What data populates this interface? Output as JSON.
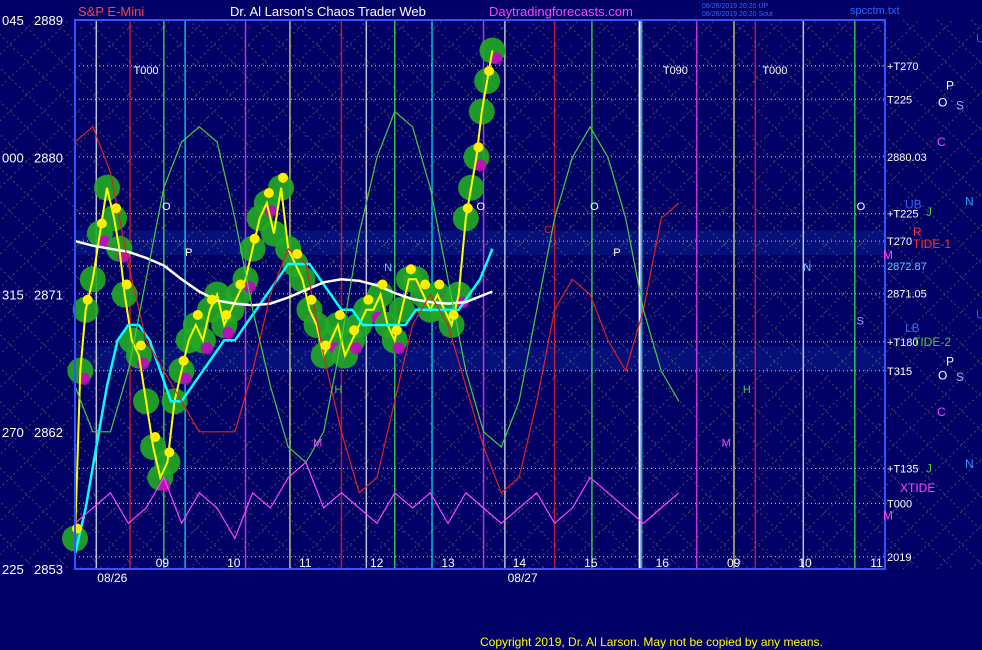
{
  "header": {
    "symbol": "S&P E-Mini",
    "title": "Dr. Al Larson's Chaos Trader Web",
    "site": "Daytradingforecasts.com",
    "stamp_line1": "08/26/2019 20:20 UP",
    "stamp_line2": "08/26/2019 20:20 Sout",
    "filename": "spcctm.txt"
  },
  "footer": {
    "copyright": "Copyright 2019, Dr. Al Larson. May not be copied by any means."
  },
  "colors": {
    "background": "#000066",
    "plot_bg": "#000066",
    "price_line": "#ffff00",
    "avg_fast": "#00ffff",
    "avg_slow": "#ffffff",
    "green_blob": "#22aa22",
    "magenta_blob": "#cc00cc",
    "grid_yellow": "#ffff66",
    "red": "#dd2222",
    "green_line": "#44cc44",
    "magenta_line": "#ff44ff",
    "frame": "#3355ff"
  },
  "chart_data": {
    "type": "line",
    "y_range": [
      2853,
      2889
    ],
    "left_axis": [
      {
        "left": "045",
        "right": "2889",
        "v": 2889
      },
      {
        "left": "000",
        "right": "2880",
        "v": 2880
      },
      {
        "left": "315",
        "right": "2871",
        "v": 2871
      },
      {
        "left": "270",
        "right": "2862",
        "v": 2862
      },
      {
        "left": "225",
        "right": "2853",
        "v": 2853
      }
    ],
    "right_labels": [
      {
        "text": "+T270",
        "v": 2886.0,
        "color": "#ffffff"
      },
      {
        "text": "T225",
        "v": 2883.8,
        "color": "#ffffff"
      },
      {
        "text": "2880.03",
        "v": 2880.03,
        "color": "#ffffff"
      },
      {
        "text": "+T225",
        "v": 2876.3,
        "color": "#ffffff"
      },
      {
        "text": "T270",
        "v": 2874.5,
        "color": "#ffffff"
      },
      {
        "text": "2872.87",
        "v": 2872.87,
        "color": "#66ccff"
      },
      {
        "text": "2871.05",
        "v": 2871.05,
        "color": "#ffffff"
      },
      {
        "text": "+T180",
        "v": 2867.9,
        "color": "#ffffff"
      },
      {
        "text": "T315",
        "v": 2866.0,
        "color": "#ffffff"
      },
      {
        "text": "+T135",
        "v": 2859.6,
        "color": "#ffffff"
      },
      {
        "text": "T000",
        "v": 2857.3,
        "color": "#ffffff"
      },
      {
        "text": "2019",
        "v": 2853.8,
        "color": "#ffffff"
      }
    ],
    "side_markers": [
      {
        "text": "U",
        "v": 2887.8,
        "x": 976,
        "color": "#3355ff"
      },
      {
        "text": "P",
        "v": 2884.7,
        "x": 946,
        "color": "#ffffff"
      },
      {
        "text": "O",
        "v": 2883.6,
        "x": 938,
        "color": "#ffffff"
      },
      {
        "text": "S",
        "v": 2883.4,
        "x": 956,
        "color": "#aaaaff"
      },
      {
        "text": "C",
        "v": 2881.0,
        "x": 937,
        "color": "#ff44ff"
      },
      {
        "text": "N",
        "v": 2877.1,
        "x": 965,
        "color": "#3399ff"
      },
      {
        "text": "UB",
        "v": 2876.9,
        "x": 905,
        "color": "#3366ff"
      },
      {
        "text": "J",
        "v": 2876.4,
        "x": 926,
        "color": "#44cc44"
      },
      {
        "text": "R",
        "v": 2875.1,
        "x": 913,
        "color": "#ff3333"
      },
      {
        "text": "TIDE-1",
        "v": 2874.3,
        "x": 913,
        "color": "#ff3333"
      },
      {
        "text": "M",
        "v": 2873.6,
        "x": 883,
        "color": "#ff44ff"
      },
      {
        "text": "U",
        "v": 2869.7,
        "x": 976,
        "color": "#3355ff"
      },
      {
        "text": "LB",
        "v": 2868.8,
        "x": 905,
        "color": "#3366ff"
      },
      {
        "text": "TIDE-2",
        "v": 2867.9,
        "x": 913,
        "color": "#44cc44"
      },
      {
        "text": "P",
        "v": 2866.6,
        "x": 946,
        "color": "#ffffff"
      },
      {
        "text": "O",
        "v": 2865.7,
        "x": 938,
        "color": "#ffffff"
      },
      {
        "text": "S",
        "v": 2865.6,
        "x": 956,
        "color": "#aaaaff"
      },
      {
        "text": "C",
        "v": 2863.3,
        "x": 937,
        "color": "#ff44ff"
      },
      {
        "text": "N",
        "v": 2859.9,
        "x": 965,
        "color": "#3399ff"
      },
      {
        "text": "J",
        "v": 2859.6,
        "x": 926,
        "color": "#44cc44"
      },
      {
        "text": "XTIDE",
        "v": 2858.3,
        "x": 900,
        "color": "#ff44ff"
      },
      {
        "text": "M",
        "v": 2856.5,
        "x": 883,
        "color": "#ff44ff"
      }
    ],
    "x_range": [
      0,
      34
    ],
    "hour_ticks": [
      {
        "text": "09",
        "x": 3
      },
      {
        "text": "10",
        "x": 6
      },
      {
        "text": "11",
        "x": 9
      },
      {
        "text": "12",
        "x": 12
      },
      {
        "text": "13",
        "x": 15
      },
      {
        "text": "14",
        "x": 18
      },
      {
        "text": "15",
        "x": 21
      },
      {
        "text": "16",
        "x": 24
      },
      {
        "text": "09",
        "x": 27
      },
      {
        "text": "10",
        "x": 30
      },
      {
        "text": "11",
        "x": 33
      }
    ],
    "date_labels": [
      {
        "text": "08/26",
        "x": 2.1
      },
      {
        "text": "08/27",
        "x": 25.2
      }
    ],
    "top_markers": [
      {
        "text": "T000",
        "x": 4.0
      },
      {
        "text": "T090",
        "x": 22.7
      },
      {
        "text": "T000",
        "x": 30.0
      }
    ],
    "plot_letters": [
      {
        "text": "O",
        "x": 4.9,
        "v": 2876.8,
        "color": "#ffffff"
      },
      {
        "text": "P",
        "x": 6.2,
        "v": 2873.8,
        "color": "#ffffff"
      },
      {
        "text": "O",
        "x": 22.6,
        "v": 2876.8,
        "color": "#ffffff"
      },
      {
        "text": "C",
        "x": 26.4,
        "v": 2875.3,
        "color": "#dd2222"
      },
      {
        "text": "O",
        "x": 29.0,
        "v": 2876.8,
        "color": "#ffffff"
      },
      {
        "text": "P",
        "x": 30.3,
        "v": 2873.8,
        "color": "#ffffff"
      },
      {
        "text": "N",
        "x": 17.4,
        "v": 2872.8,
        "color": "#66ccff"
      },
      {
        "text": "N",
        "x": 41.0,
        "v": 2872.8,
        "color": "#66ccff"
      },
      {
        "text": "M",
        "x": 13.4,
        "v": 2861.3,
        "color": "#ff44ff"
      },
      {
        "text": "M",
        "x": 36.4,
        "v": 2861.3,
        "color": "#ff44ff"
      },
      {
        "text": "H",
        "x": 14.6,
        "v": 2864.8,
        "color": "#44cc44"
      },
      {
        "text": "H",
        "x": 37.6,
        "v": 2864.8,
        "color": "#44cc44"
      },
      {
        "text": "S",
        "x": 44.0,
        "v": 2869.3,
        "color": "#aaaaff"
      },
      {
        "text": "O",
        "x": 44.0,
        "v": 2876.8,
        "color": "#ffffff"
      }
    ],
    "series": [
      {
        "name": "price",
        "kind": "price",
        "x": [
          0.0,
          0.3,
          0.6,
          1.0,
          1.4,
          1.8,
          2.2,
          2.5,
          2.8,
          3.2,
          3.6,
          4.0,
          4.4,
          4.8,
          5.2,
          5.6,
          6.0,
          6.4,
          6.8,
          7.2,
          7.6,
          8.0,
          8.4,
          8.8,
          9.2,
          9.6,
          10.0,
          10.4,
          10.8,
          11.2,
          11.6,
          12.0,
          12.4,
          12.8,
          13.2,
          13.6,
          14.0,
          14.4,
          14.8,
          15.2,
          15.6,
          16.0,
          16.4,
          16.8,
          17.2,
          17.6,
          18.0,
          18.4,
          18.8,
          19.2,
          19.6,
          20.0,
          20.4,
          20.8,
          21.2,
          21.6,
          22.0,
          22.3,
          22.6,
          22.9,
          23.2,
          23.5
        ],
        "y": [
          2855,
          2866,
          2870,
          2872,
          2875,
          2878,
          2876,
          2874,
          2871,
          2868,
          2867,
          2864,
          2861,
          2859,
          2860,
          2864,
          2866,
          2868,
          2869,
          2868,
          2870,
          2871,
          2869,
          2870,
          2871,
          2872,
          2874,
          2876,
          2877,
          2875,
          2878,
          2874,
          2873,
          2872,
          2870,
          2869,
          2867,
          2868,
          2869,
          2867,
          2868,
          2869,
          2870,
          2870,
          2871,
          2869,
          2868,
          2870,
          2872,
          2872,
          2871,
          2870,
          2871,
          2870,
          2869,
          2871,
          2876,
          2878,
          2880,
          2883,
          2885,
          2887
        ]
      },
      {
        "name": "avg_fast",
        "kind": "avg_fast",
        "x": [
          0.0,
          0.6,
          1.2,
          1.8,
          2.4,
          3.0,
          3.6,
          4.2,
          4.8,
          5.4,
          6.0,
          6.6,
          7.2,
          7.8,
          8.4,
          9.0,
          9.6,
          10.2,
          10.8,
          11.4,
          12.0,
          12.6,
          13.2,
          13.8,
          14.4,
          15.0,
          15.6,
          16.2,
          16.8,
          17.4,
          18.0,
          18.6,
          19.2,
          19.8,
          20.4,
          21.0,
          21.6,
          22.2,
          22.8,
          23.5
        ],
        "y": [
          2854,
          2857,
          2861,
          2865,
          2868,
          2869,
          2869,
          2868,
          2866,
          2864,
          2864,
          2865,
          2866,
          2867,
          2868,
          2868,
          2869,
          2870,
          2871,
          2872,
          2873,
          2873,
          2873,
          2872,
          2871,
          2870,
          2870,
          2869,
          2869,
          2869,
          2869,
          2869,
          2870,
          2870,
          2870,
          2870,
          2870,
          2871,
          2872,
          2874
        ]
      },
      {
        "name": "avg_slow",
        "kind": "avg_slow",
        "x": [
          0.0,
          1.0,
          2.0,
          3.0,
          4.0,
          5.0,
          6.0,
          7.0,
          8.0,
          9.0,
          10.0,
          11.0,
          12.0,
          13.0,
          14.0,
          15.0,
          16.0,
          17.0,
          18.0,
          19.0,
          20.0,
          21.0,
          22.0,
          23.5
        ],
        "y": [
          2874.5,
          2874.2,
          2874.0,
          2873.8,
          2873.4,
          2872.9,
          2872.0,
          2871.2,
          2870.6,
          2870.4,
          2870.3,
          2870.4,
          2870.8,
          2871.3,
          2871.8,
          2872.0,
          2871.9,
          2871.6,
          2871.1,
          2870.7,
          2870.5,
          2870.4,
          2870.5,
          2871.2
        ]
      },
      {
        "name": "red_tide",
        "kind": "red",
        "x": [
          0.0,
          1.0,
          2.0,
          3.0,
          4.0,
          5.0,
          6.0,
          7.0,
          8.0,
          9.0,
          10.0,
          11.0,
          12.0,
          13.0,
          14.0,
          15.0,
          16.0,
          17.0,
          18.0,
          19.0,
          20.0,
          21.0,
          22.0,
          23.0,
          24.0,
          25.0,
          26.0,
          27.0,
          28.0,
          29.0,
          30.0,
          31.0,
          32.0,
          33.0,
          34.0
        ],
        "y": [
          2881,
          2882,
          2879,
          2873,
          2868,
          2866,
          2864,
          2862,
          2862,
          2862,
          2866,
          2871,
          2874,
          2873,
          2867,
          2862,
          2858,
          2859,
          2864,
          2869,
          2871,
          2869,
          2865,
          2861,
          2858,
          2859,
          2864,
          2870,
          2872,
          2871,
          2868,
          2866,
          2870,
          2876,
          2877
        ]
      },
      {
        "name": "green_tide",
        "kind": "green",
        "x": [
          0.0,
          1.0,
          2.0,
          3.0,
          4.0,
          5.0,
          6.0,
          7.0,
          8.0,
          9.0,
          10.0,
          11.0,
          12.0,
          13.0,
          14.0,
          15.0,
          16.0,
          17.0,
          18.0,
          19.0,
          20.0,
          21.0,
          22.0,
          23.0,
          24.0,
          25.0,
          26.0,
          27.0,
          28.0,
          29.0,
          30.0,
          31.0,
          32.0,
          33.0,
          34.0
        ],
        "y": [
          2865,
          2862,
          2862,
          2866,
          2872,
          2878,
          2881,
          2882,
          2881,
          2876,
          2870,
          2865,
          2861,
          2860,
          2862,
          2868,
          2875,
          2880,
          2883,
          2882,
          2878,
          2872,
          2866,
          2862,
          2861,
          2864,
          2870,
          2876,
          2880,
          2882,
          2880,
          2876,
          2870,
          2866,
          2864
        ]
      },
      {
        "name": "magenta_osc",
        "kind": "magenta",
        "x": [
          0,
          1,
          2,
          3,
          4,
          5,
          6,
          7,
          8,
          9,
          10,
          11,
          12,
          13,
          14,
          15,
          16,
          17,
          18,
          19,
          20,
          21,
          22,
          23,
          24,
          25,
          26,
          27,
          28,
          29,
          30,
          31,
          32,
          33,
          34
        ],
        "y": [
          2856,
          2857,
          2858,
          2856,
          2857,
          2859,
          2856,
          2858,
          2857,
          2855,
          2858,
          2857,
          2859,
          2860,
          2857,
          2858,
          2857,
          2856,
          2858,
          2857,
          2858,
          2856,
          2858,
          2857,
          2856,
          2857,
          2858,
          2856,
          2857,
          2859,
          2858,
          2857,
          2856,
          2857,
          2858
        ]
      }
    ]
  }
}
